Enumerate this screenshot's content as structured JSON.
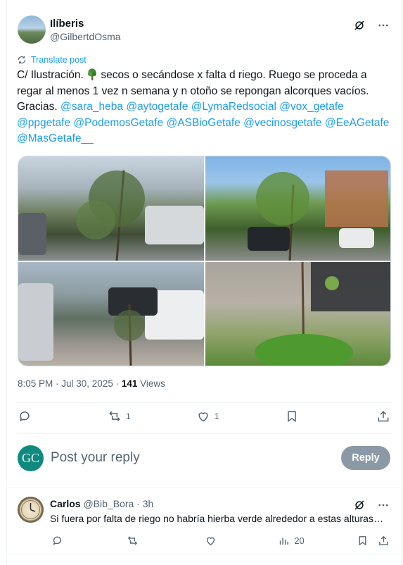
{
  "post": {
    "display_name": "Ilíberis",
    "handle": "@GilbertdOsma",
    "translate_label": "Translate post",
    "text_parts": {
      "p1": "C/ Ilustración. ",
      "p2": " secos o secándose x falta d riego. Ruego se proceda a regar al menos 1 vez n semana y n otoño se repongan alcorques vacíos. Gracias. "
    },
    "mentions": [
      "@sara_heba",
      "@aytogetafe",
      "@LymaRedsocial",
      "@vox_getafe",
      "@ppgetafe",
      "@PodemosGetafe",
      "@ASBioGetafe",
      "@vecinosgetafe",
      "@EeAGetafe",
      "@MasGetafe__"
    ],
    "timestamp": "8:05 PM · Jul 30, 2025 · ",
    "views_count": "141",
    "views_label": " Views",
    "actions": {
      "reply_count": "",
      "repost_count": "1",
      "like_count": "1"
    }
  },
  "reply_composer": {
    "avatar_initials": "GC",
    "placeholder": "Post your reply",
    "button_label": "Reply"
  },
  "comment": {
    "display_name": "Carlos",
    "handle": "@Bib_Bora",
    "time": "· 3h",
    "text": "Si fuera por falta de riego no habría hierba verde alrededor a estas alturas…",
    "views_count": "20"
  },
  "colors": {
    "accent": "#1d9bf0",
    "muted": "#536471",
    "reply_button": "#8b98a5",
    "avatar_gc": "#108a7f"
  }
}
